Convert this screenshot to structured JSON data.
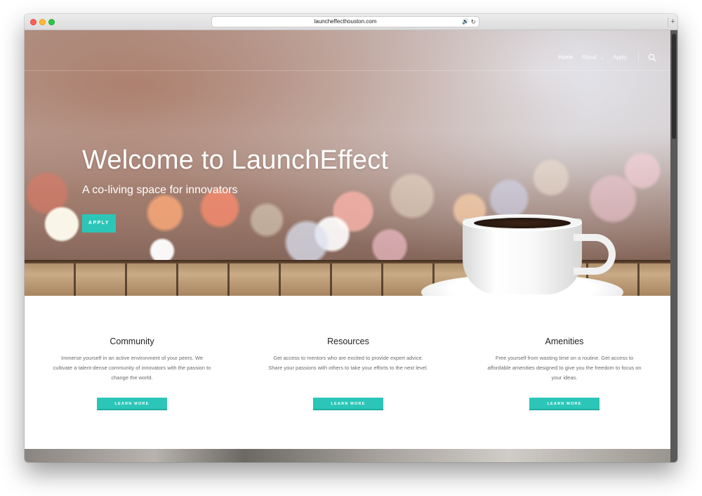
{
  "browser": {
    "url": "launcheffecthouston.com",
    "new_tab_symbol": "+"
  },
  "nav": {
    "items": [
      "Home",
      "About",
      "Apply"
    ],
    "active": "Home",
    "about_caret": "⌄"
  },
  "hero": {
    "title": "Welcome to LaunchEffect",
    "subtitle": "A co-living space for innovators",
    "button_label": "APPLY"
  },
  "features": [
    {
      "title": "Community",
      "text": "Immerse yourself in an active environment of your peers. We cultivate a talent-dense community of innovators with the passion to change the world.",
      "button_label": "LEARN MORE"
    },
    {
      "title": "Resources",
      "text": "Get access to mentors who are excited to provide expert advice. Share your passions with others to take your efforts to the next level.",
      "button_label": "LEARN MORE"
    },
    {
      "title": "Amenities",
      "text": "Free yourself from wasting time on a routine. Get access to affordable amenities designed to give you the freedom to focus on your ideas.",
      "button_label": "LEARN MORE"
    }
  ],
  "colors": {
    "accent": "#2bc6b8"
  }
}
